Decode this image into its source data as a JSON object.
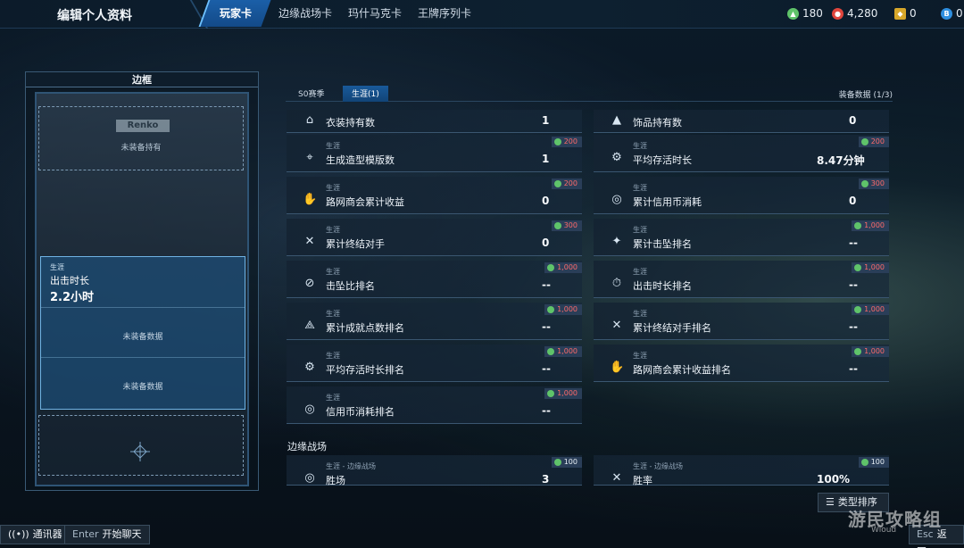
{
  "header": {
    "page_title": "编辑个人资料",
    "tabs": [
      "玩家卡",
      "边缘战场卡",
      "玛什马克卡",
      "王牌序列卡"
    ],
    "currencies": [
      {
        "icon": "green-token-icon",
        "value": "180",
        "color": "#5fc36a"
      },
      {
        "icon": "red-credit-icon",
        "value": "4,280",
        "color": "#e0453c"
      },
      {
        "icon": "gold-coin-icon",
        "value": "0",
        "color": "#d7a72a"
      },
      {
        "icon": "blue-coin-icon",
        "value": "0",
        "color": "#2e8fe0"
      }
    ]
  },
  "frame_panel": {
    "title": "边框",
    "nameplate": "Renko",
    "slot_empty_top": "未装备持有",
    "stat_card": {
      "category": "生涯",
      "label": "出击时长",
      "value": "2.2小时",
      "empty_1": "未装备数据",
      "empty_2": "未装备数据"
    }
  },
  "content": {
    "tabs": [
      "S0赛季",
      "生涯(1)"
    ],
    "equip_data": "装备数据 (1/3)",
    "stats": [
      {
        "category": "",
        "label": "衣装持有数",
        "value": "1",
        "reward": "",
        "icon": "outfit-icon"
      },
      {
        "category": "",
        "label": "饰品持有数",
        "value": "0",
        "reward": "",
        "icon": "accessory-icon"
      },
      {
        "category": "生涯",
        "label": "生成造型模版数",
        "value": "1",
        "reward": "200",
        "icon": "template-icon"
      },
      {
        "category": "生涯",
        "label": "平均存活时长",
        "value": "8.47分钟",
        "reward": "200",
        "icon": "survival-icon"
      },
      {
        "category": "生涯",
        "label": "路网商会累计收益",
        "value": "0",
        "reward": "200",
        "icon": "handshake-icon"
      },
      {
        "category": "生涯",
        "label": "累计信用币消耗",
        "value": "0",
        "reward": "300",
        "icon": "credit-icon"
      },
      {
        "category": "生涯",
        "label": "累计终结对手",
        "value": "0",
        "reward": "300",
        "icon": "eliminate-icon"
      },
      {
        "category": "生涯",
        "label": "累计击坠排名",
        "value": "--",
        "reward": "1,000",
        "icon": "shootdown-icon"
      },
      {
        "category": "生涯",
        "label": "击坠比排名",
        "value": "--",
        "reward": "1,000",
        "icon": "ratio-icon"
      },
      {
        "category": "生涯",
        "label": "出击时长排名",
        "value": "--",
        "reward": "1,000",
        "icon": "clock-icon"
      },
      {
        "category": "生涯",
        "label": "累计成就点数排名",
        "value": "--",
        "reward": "1,000",
        "icon": "achievement-icon"
      },
      {
        "category": "生涯",
        "label": "累计终结对手排名",
        "value": "--",
        "reward": "1,000",
        "icon": "eliminate-rank-icon"
      },
      {
        "category": "生涯",
        "label": "平均存活时长排名",
        "value": "--",
        "reward": "1,000",
        "icon": "survival-rank-icon"
      },
      {
        "category": "生涯",
        "label": "路网商会累计收益排名",
        "value": "--",
        "reward": "1,000",
        "icon": "handshake-rank-icon"
      },
      {
        "category": "生涯",
        "label": "信用币消耗排名",
        "value": "--",
        "reward": "1,000",
        "icon": "credit-rank-icon"
      }
    ],
    "section_label": "边缘战场",
    "battlefield_stats": [
      {
        "category": "生涯 - 边缘战场",
        "label": "胜场",
        "value": "3",
        "reward": "100",
        "icon": "wins-icon"
      },
      {
        "category": "生涯 - 边缘战场",
        "label": "胜率",
        "value": "100%",
        "reward": "100",
        "icon": "winrate-icon"
      }
    ],
    "sort_button": "类型排序"
  },
  "footer": {
    "comm_label": "通讯器",
    "chat_key": "Enter",
    "chat_label": "开始聊天",
    "back_key": "Esc",
    "back_label": "返回"
  },
  "watermark": {
    "main": "游民攻略组",
    "sub": "Wioud"
  }
}
